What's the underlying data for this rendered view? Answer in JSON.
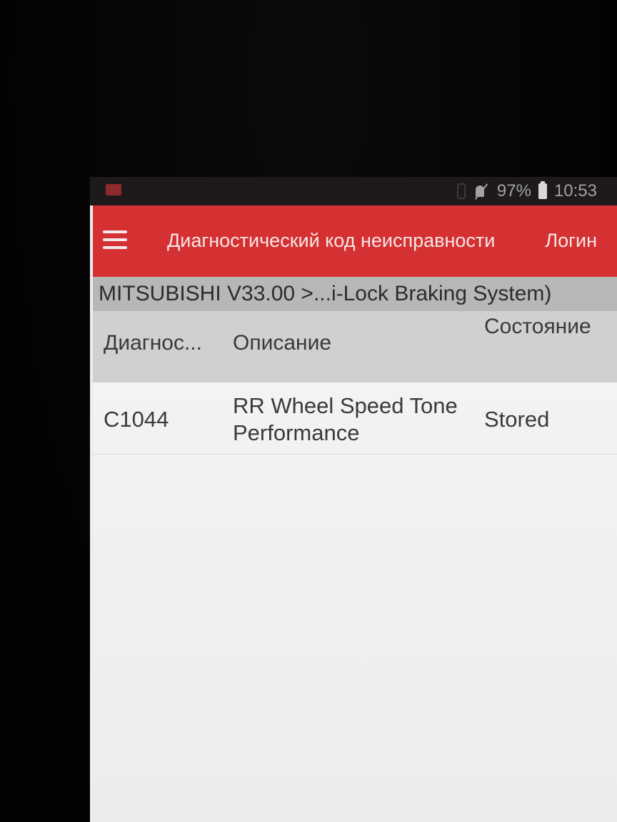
{
  "status_bar": {
    "battery": "97%",
    "time": "10:53",
    "icons": [
      "app-notification-icon",
      "vibrate-icon",
      "mute-icon",
      "battery-icon"
    ]
  },
  "app_bar": {
    "menu_icon": "hamburger-menu-icon",
    "title": "Диагностический код неисправности",
    "login": "Логин",
    "color": "#d53133"
  },
  "breadcrumb": {
    "text": "MITSUBISHI V33.00 >...i-Lock Braking System)"
  },
  "table": {
    "headers": {
      "code": "Диагнос...",
      "description": "Описание",
      "state": "Состояние"
    },
    "rows": [
      {
        "code": "C1044",
        "description": "RR Wheel Speed Tone Performance",
        "state": "Stored"
      }
    ]
  }
}
